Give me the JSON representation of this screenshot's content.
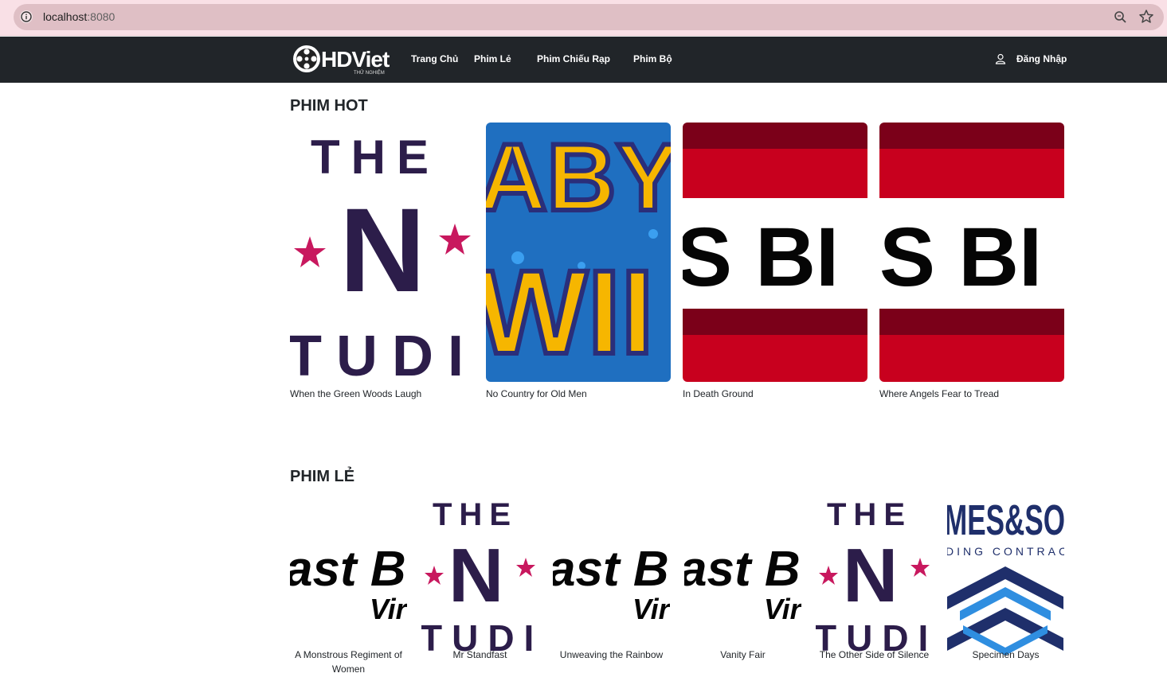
{
  "browser": {
    "host": "localhost",
    "port": ":8080",
    "icons": [
      "info-icon",
      "zoom-icon",
      "bookmark-star-icon"
    ]
  },
  "navbar": {
    "logo_text": "HDViet",
    "logo_sub": "THỬ NGHIỆM",
    "links": [
      "Trang Chủ",
      "Phim Lẻ",
      "Phim Chiếu Rạp",
      "Phim Bộ"
    ],
    "login_label": "Đăng Nhập",
    "login_icon": "user-icon",
    "background": "#212529"
  },
  "sections": {
    "hot": {
      "title": "PHIM HOT",
      "movies": [
        {
          "title": "When the Green Woods Laugh",
          "poster": "the-n-studio"
        },
        {
          "title": "No Country for Old Men",
          "poster": "baby-wig"
        },
        {
          "title": "In Death Ground",
          "poster": "bs-bi-stripes"
        },
        {
          "title": "Where Angels Fear to Tread",
          "poster": "bs-bi-stripes"
        }
      ]
    },
    "le": {
      "title": "PHIM LẺ",
      "movies": [
        {
          "title": "A Monstrous Regiment of Women",
          "poster": "ast-b-vir"
        },
        {
          "title": "Mr Standfast",
          "poster": "the-n-studio"
        },
        {
          "title": "Unweaving the Rainbow",
          "poster": "ast-b-vir"
        },
        {
          "title": "Vanity Fair",
          "poster": "ast-b-vir"
        },
        {
          "title": "The Other Side of Silence",
          "poster": "the-n-studio"
        },
        {
          "title": "Specimen Days",
          "poster": "mes-so-contract"
        }
      ]
    }
  },
  "poster_text": {
    "the": "THE",
    "n": "N",
    "tudi": "TUDI",
    "baby_top": "ABY",
    "baby_bottom": "WII",
    "sbi": "S BI",
    "ast_b": "ast B",
    "vir": "Vir",
    "mes_so": "MES&SO",
    "contrac": "DING CONTRAC"
  },
  "colors": {
    "purple": "#2c1d4a",
    "magenta": "#c8185e",
    "red": "#c8001e",
    "dark_red": "#7b0019",
    "navy": "#1f2f6b",
    "sky": "#2f8ee0",
    "yellow": "#f6b600"
  }
}
